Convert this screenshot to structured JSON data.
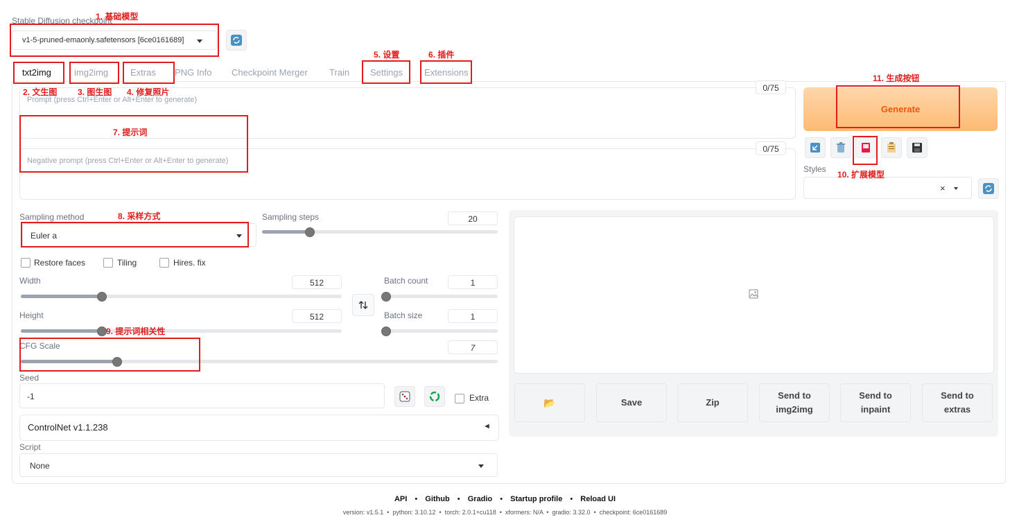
{
  "checkpoint": {
    "label": "Stable Diffusion checkpoint",
    "value": "v1-5-pruned-emaonly.safetensors [6ce0161689]"
  },
  "tabs": [
    "txt2img",
    "img2img",
    "Extras",
    "PNG Info",
    "Checkpoint Merger",
    "Train",
    "Settings",
    "Extensions"
  ],
  "prompt": {
    "placeholder": "Prompt (press Ctrl+Enter or Alt+Enter to generate)",
    "counter": "0/75"
  },
  "negative_prompt": {
    "placeholder": "Negative prompt (press Ctrl+Enter or Alt+Enter to generate)",
    "counter": "0/75"
  },
  "generate": {
    "label": "Generate"
  },
  "styles": {
    "label": "Styles",
    "clear": "×"
  },
  "sampling": {
    "method_label": "Sampling method",
    "method_value": "Euler a",
    "steps_label": "Sampling steps",
    "steps_value": "20",
    "steps_fraction": 0.2
  },
  "checkboxes": [
    "Restore faces",
    "Tiling",
    "Hires. fix"
  ],
  "width": {
    "label": "Width",
    "value": "512",
    "fraction": 0.25
  },
  "height": {
    "label": "Height",
    "value": "512",
    "fraction": 0.25
  },
  "batch_count": {
    "label": "Batch count",
    "value": "1",
    "fraction": 0
  },
  "batch_size": {
    "label": "Batch size",
    "value": "1",
    "fraction": 0
  },
  "cfg": {
    "label": "CFG Scale",
    "value": "7",
    "fraction": 0.2
  },
  "seed": {
    "label": "Seed",
    "value": "-1",
    "extra_label": "Extra"
  },
  "controlnet": {
    "label": "ControlNet v1.1.238",
    "toggle": "◄"
  },
  "script": {
    "label": "Script",
    "value": "None"
  },
  "output_buttons": [
    {
      "label": "📂"
    },
    {
      "label": "Save"
    },
    {
      "label": "Zip"
    },
    {
      "label": "Send to img2img"
    },
    {
      "label": "Send to inpaint"
    },
    {
      "label": "Send to extras"
    }
  ],
  "annotations": [
    "1. 基础模型",
    "2. 文生图",
    "3. 图生图",
    "4. 修复照片",
    "5. 设置",
    "6. 插件",
    "7. 提示词",
    "8. 采样方式",
    "9. 提示词相关性",
    "10. 扩展模型",
    "11. 生成按钮"
  ],
  "footer": {
    "links": [
      "API",
      "Github",
      "Gradio",
      "Startup profile",
      "Reload UI"
    ],
    "separator": "•",
    "version_text": "version: v1.5.1  •  python: 3.10.12  •  torch: 2.0.1+cu118  •  xformers: N/A  •  gradio: 3.32.0  •  checkpoint: 6ce0161689"
  },
  "colors": {
    "accent": "#fb923c",
    "annotation": "#e21c1c"
  }
}
